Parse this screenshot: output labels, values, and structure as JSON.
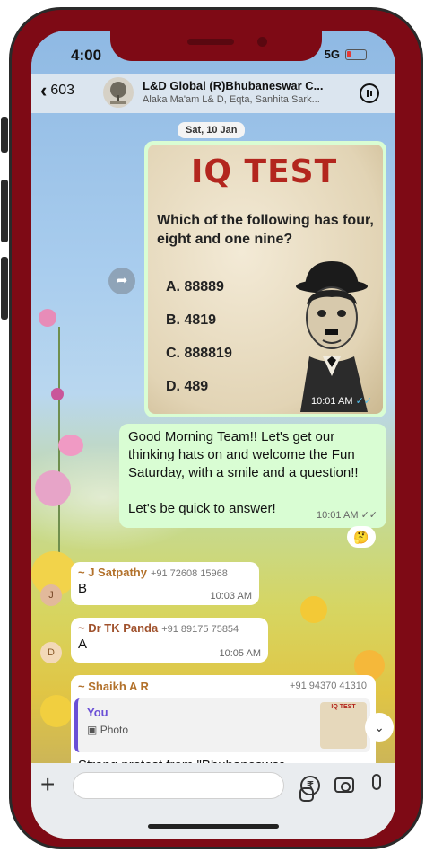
{
  "status_bar": {
    "time": "4:00",
    "network": "5G"
  },
  "header": {
    "back_count": "603",
    "title": "L&D Global (R)Bhubaneswar C...",
    "subtitle": "Alaka Ma'am L& D, Eqta, Sanhita Sark..."
  },
  "date_separator": "Sat, 10 Jan",
  "image_message": {
    "card_title": "IQ TEST",
    "question": "Which of the following has four, eight and one nine?",
    "options": [
      "A. 88889",
      "B. 4819",
      "C. 888819",
      "D. 489"
    ],
    "time": "10:01 AM"
  },
  "text_message": {
    "line1": "Good Morning Team!! Let's get our thinking hats on and welcome the Fun Saturday, with a smile and a question!!",
    "line2": "Let's be quick to answer!",
    "time": "10:01 AM",
    "reaction": "🤔"
  },
  "replies": [
    {
      "avatar": "J",
      "sender": "~ J Satpathy",
      "phone": "+91 72608 15968",
      "text": "B",
      "time": "10:03 AM",
      "color": "#b2712b"
    },
    {
      "avatar": "D",
      "sender": "~ Dr TK Panda",
      "phone": "+91 89175 75854",
      "text": "A",
      "time": "10:05 AM",
      "color": "#a0522d"
    }
  ],
  "quoted_reply": {
    "sender": "~ Shaikh A R",
    "phone": "+91 94370 41310",
    "quote_author": "You",
    "quote_type": "Photo",
    "thumb_title": "IQ TEST",
    "text": "Strong protest from \"Bhubaneswar"
  },
  "colors": {
    "frame": "#7e0a15",
    "outgoing": "#d9fdd3",
    "incoming": "#ffffff",
    "accent": "#6a4fd6"
  }
}
